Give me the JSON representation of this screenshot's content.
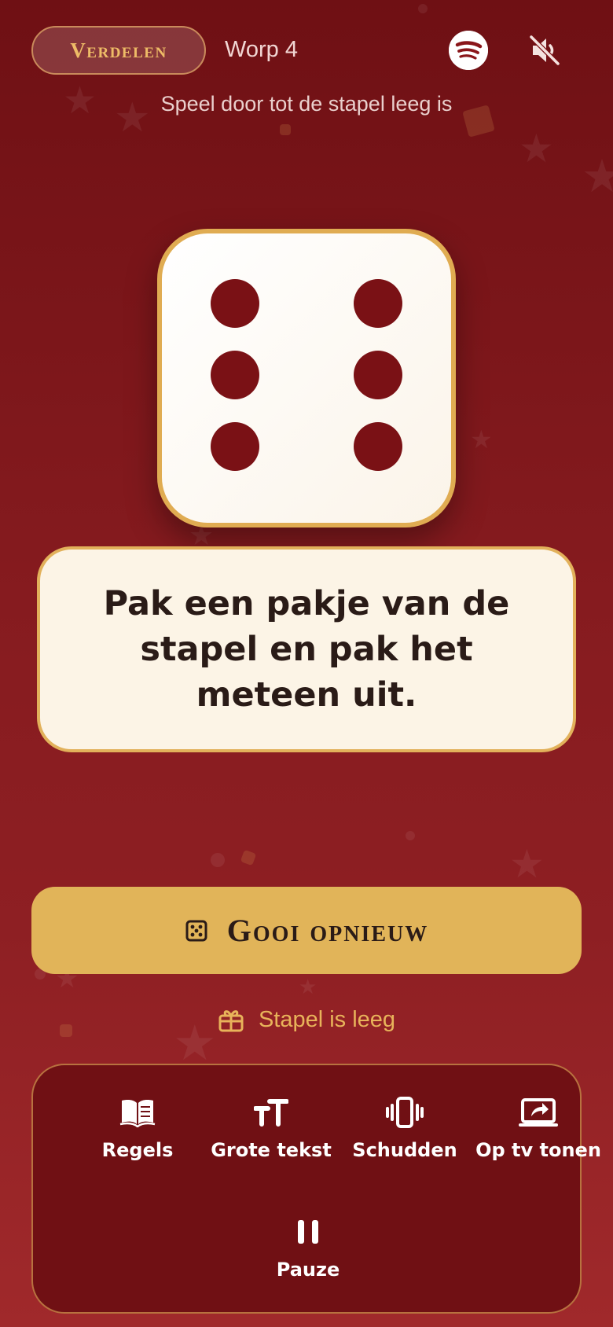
{
  "header": {
    "mode_label": "Verdelen",
    "throw_label": "Worp 4",
    "subtitle": "Speel door tot de stapel leeg is",
    "icons": [
      "spotify-icon",
      "sound-muted-icon"
    ]
  },
  "die": {
    "value": 6,
    "pip_color": "#7a1115",
    "border_color": "#e0ac52"
  },
  "task": {
    "text": "Pak een pakje van de stapel en pak het meteen uit."
  },
  "reroll": {
    "label": "Gooi opnieuw",
    "icon": "dice-icon"
  },
  "deck_status": {
    "label": "Stapel is leeg",
    "icon": "gift-icon"
  },
  "toolbar": {
    "items": [
      {
        "label": "Regels",
        "icon": "book-icon"
      },
      {
        "label": "Grote tekst",
        "icon": "text-size-icon"
      },
      {
        "label": "Schudden",
        "icon": "vibrate-icon"
      },
      {
        "label": "Op tv tonen",
        "icon": "cast-icon"
      },
      {
        "label": "Pauze",
        "icon": "pause-icon"
      }
    ]
  },
  "colors": {
    "accent_gold": "#e1b459",
    "background_red": "#861b1f",
    "panel_red": "#701014",
    "card_cream": "#fcf4e6"
  }
}
